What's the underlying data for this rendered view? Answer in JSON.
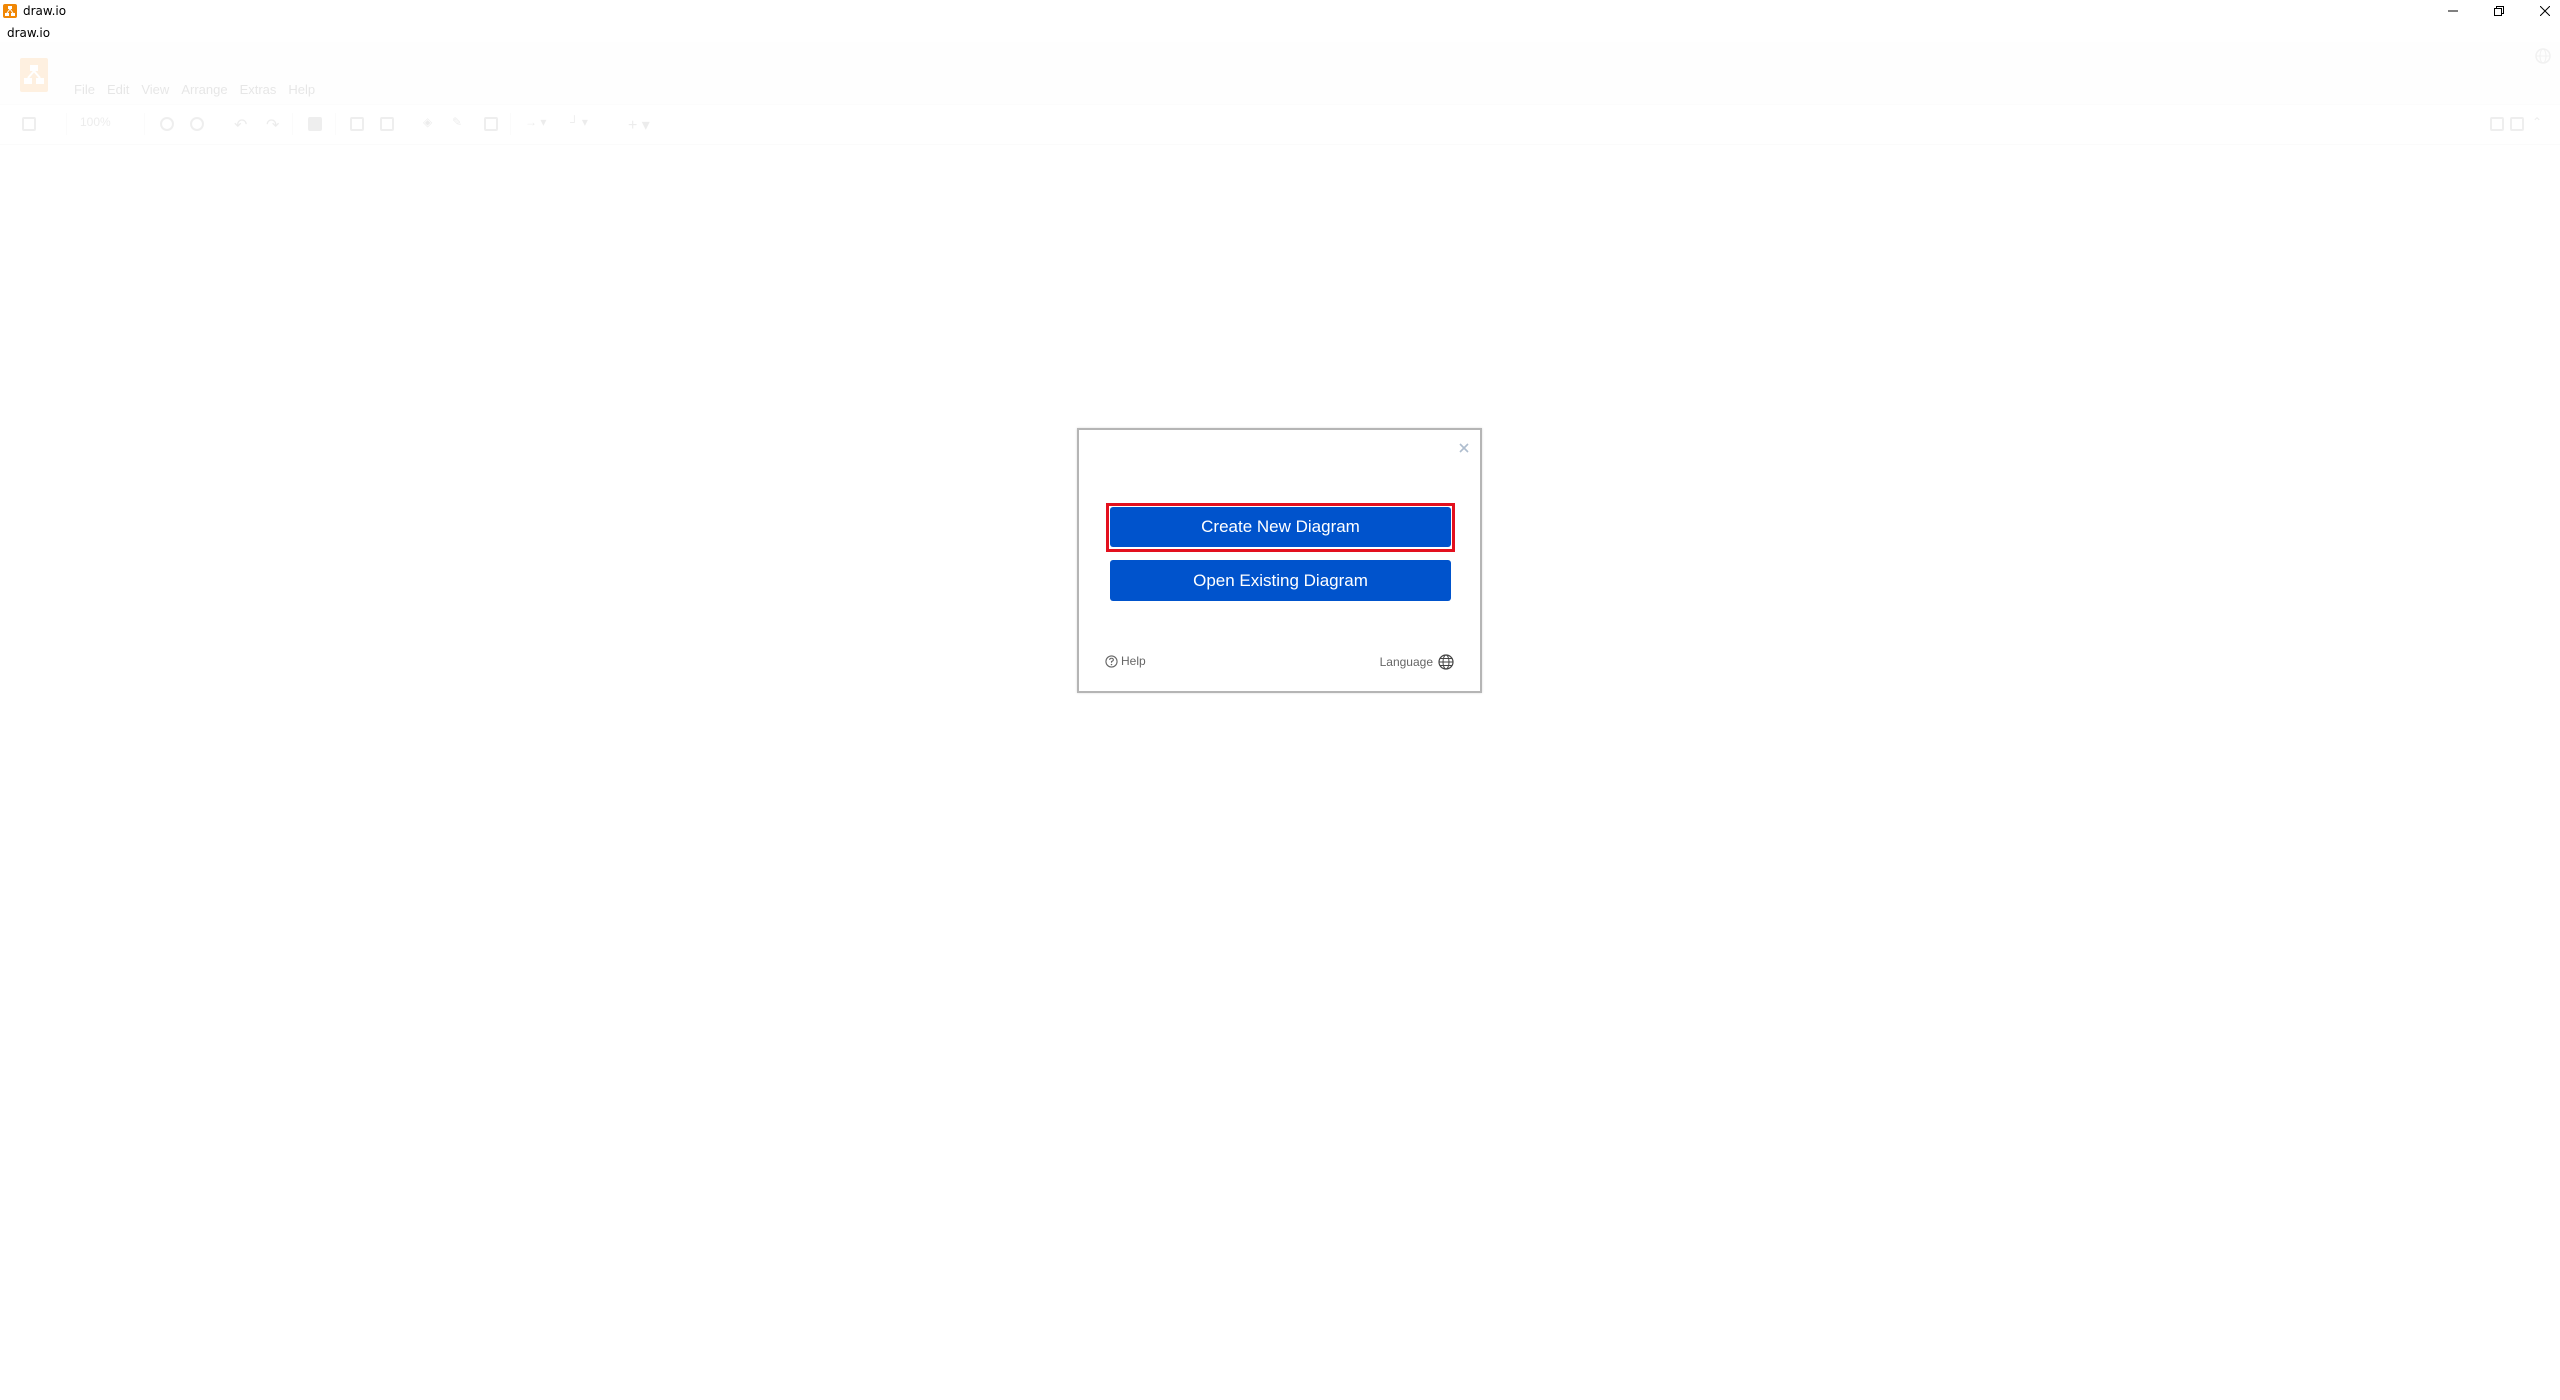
{
  "window": {
    "title": "draw.io",
    "subtitle": "draw.io",
    "controls": {
      "minimize": "minimize",
      "restore": "restore",
      "close": "close"
    }
  },
  "menubar": {
    "items": [
      "File",
      "Edit",
      "View",
      "Arrange",
      "Extras",
      "Help"
    ]
  },
  "toolbar": {
    "zoom": "100%",
    "icons": [
      "format-panel-icon",
      "zoom-in-icon",
      "zoom-out-icon",
      "undo-icon",
      "redo-icon",
      "delete-icon",
      "to-front-icon",
      "to-back-icon",
      "fill-color-icon",
      "line-color-icon",
      "shadow-icon",
      "connection-icon",
      "waypoints-icon",
      "insert-icon",
      "fullscreen-icon",
      "toggle-panel-icon",
      "collapse-icon"
    ]
  },
  "dialog": {
    "close_label": "×",
    "create_label": "Create New Diagram",
    "open_label": "Open Existing Diagram",
    "help_label": "Help",
    "language_label": "Language"
  },
  "colors": {
    "brand": "#f08705",
    "primary_button": "#0053cc",
    "focus_ring": "#e3101e"
  }
}
